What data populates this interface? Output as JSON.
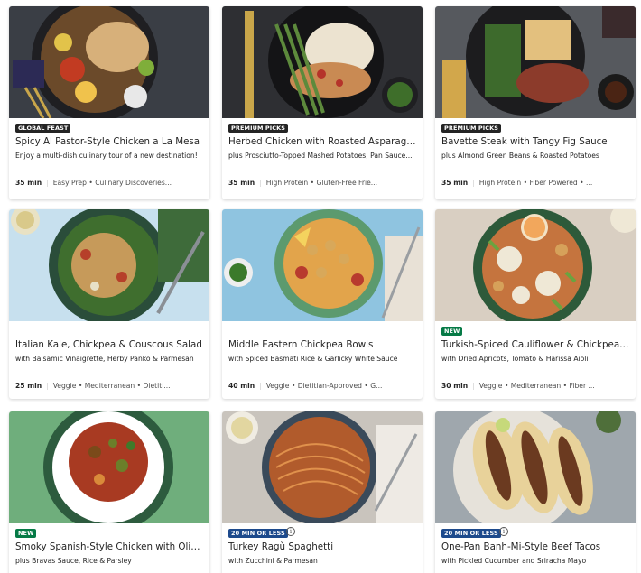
{
  "recipes": [
    {
      "badge": "GLOBAL FEAST",
      "badge_style": "dark",
      "title": "Spicy Al Pastor-Style Chicken a La Mesa",
      "subtitle": "Enjoy a multi-dish culinary tour of a new destination!",
      "time": "35 min",
      "tags": "Easy Prep • Culinary Discoveries..."
    },
    {
      "badge": "PREMIUM PICKS",
      "badge_style": "dark",
      "title": "Herbed Chicken with Roasted Asparagus",
      "subtitle": "plus Prosciutto-Topped Mashed Potatoes, Pan Sauce...",
      "time": "35 min",
      "tags": "High Protein • Gluten-Free Frie..."
    },
    {
      "badge": "PREMIUM PICKS",
      "badge_style": "dark",
      "title": "Bavette Steak with Tangy Fig Sauce",
      "subtitle": "plus Almond Green Beans & Roasted Potatoes",
      "time": "35 min",
      "tags": "High Protein • Fiber Powered • ..."
    },
    {
      "badge": "",
      "badge_style": "",
      "title": "Italian Kale, Chickpea & Couscous Salad",
      "subtitle": "with Balsamic Vinaigrette, Herby Panko & Parmesan",
      "time": "25 min",
      "tags": "Veggie • Mediterranean • Dietiti..."
    },
    {
      "badge": "",
      "badge_style": "",
      "title": "Middle Eastern Chickpea Bowls",
      "subtitle": "with Spiced Basmati Rice & Garlicky White Sauce",
      "time": "40 min",
      "tags": "Veggie • Dietitian-Approved • G..."
    },
    {
      "badge": "NEW",
      "badge_style": "green",
      "title": "Turkish-Spiced Cauliflower & Chickpea ...",
      "subtitle": "with Dried Apricots, Tomato & Harissa Aioli",
      "time": "30 min",
      "tags": "Veggie • Mediterranean • Fiber ..."
    },
    {
      "badge": "NEW",
      "badge_style": "green",
      "title": "Smoky Spanish-Style Chicken with Oliv...",
      "subtitle": "plus Bravas Sauce, Rice & Parsley",
      "time": "",
      "tags": ""
    },
    {
      "badge": "20 MIN OR LESS",
      "badge_style": "blue",
      "title": "Turkey Ragù Spaghetti",
      "subtitle": "with Zucchini & Parmesan",
      "time": "",
      "tags": ""
    },
    {
      "badge": "20 MIN OR LESS",
      "badge_style": "blue",
      "title": "One-Pan Banh-Mi-Style Beef Tacos",
      "subtitle": "with Pickled Cucumber and Sriracha Mayo",
      "time": "",
      "tags": ""
    }
  ],
  "info_icon_glyph": "i",
  "colors": {
    "badge_dark": "#242424",
    "badge_new": "#067a46",
    "badge_quick": "#1d4a8c"
  }
}
